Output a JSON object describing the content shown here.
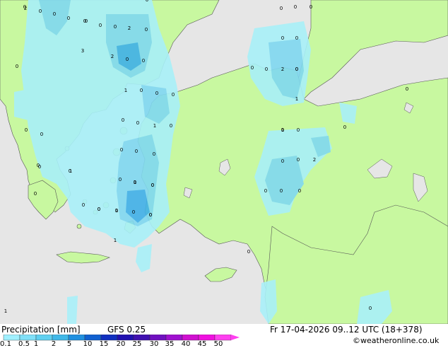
{
  "footer": {
    "title": "Precipitation [mm]",
    "model": "GFS 0.25",
    "valid_time": "Fr 17-04-2026 09..12 UTC (18+378)",
    "credit": "©weatheronline.co.uk"
  },
  "legend": {
    "labels": [
      "0.1",
      "0.5",
      "1",
      "2",
      "5",
      "10",
      "15",
      "20",
      "25",
      "30",
      "35",
      "40",
      "45",
      "50"
    ],
    "colors": [
      "#a0f0ff",
      "#80e0f8",
      "#60d0f0",
      "#40b8e8",
      "#2090e0",
      "#1060d0",
      "#1030c0",
      "#2010b0",
      "#4010b0",
      "#7010c0",
      "#a010d0",
      "#d010d0",
      "#f010e0",
      "#ff40f0"
    ]
  },
  "map": {
    "colors": {
      "sea": "#e6e6e6",
      "land": "#c8f8a0",
      "precip_light": "#a8f0f8",
      "precip_medium": "#80d8f0",
      "precip_heavy": "#40b0e8"
    },
    "values": [
      "0",
      "0",
      "0",
      "0",
      "0",
      "0",
      "0",
      "0",
      "0",
      "0",
      "2",
      "0",
      "0",
      "3",
      "2",
      "0",
      "0",
      "0",
      "0",
      "0",
      "0",
      "0",
      "2",
      "0",
      "1",
      "0",
      "0",
      "0",
      "0",
      "1",
      "0",
      "0",
      "1",
      "0",
      "0",
      "0",
      "0",
      "0",
      "0",
      "0",
      "0",
      "0",
      "0",
      "1",
      "0",
      "0",
      "2",
      "0",
      "1",
      "0",
      "0",
      "0",
      "0",
      "0",
      "0",
      "0",
      "1",
      "0",
      "0",
      "1",
      "0",
      "1",
      "0",
      "2",
      "0",
      "0",
      "1",
      "0",
      "0",
      "0",
      "0",
      "0",
      "0",
      "0"
    ]
  }
}
